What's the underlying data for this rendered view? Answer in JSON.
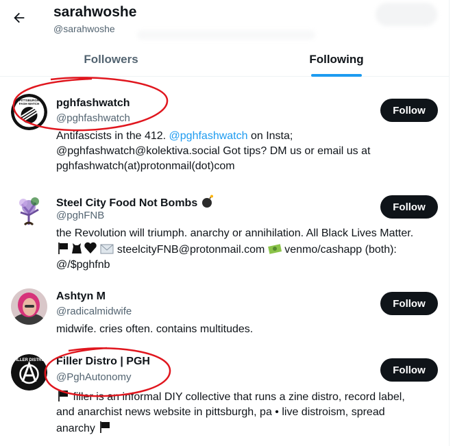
{
  "header": {
    "title": "sarahwoshe",
    "handle": "@sarahwoshe"
  },
  "tabs": [
    {
      "label": "Followers",
      "active": false
    },
    {
      "label": "Following",
      "active": true
    }
  ],
  "users": [
    {
      "name": "pghfashwatch",
      "handle": "@pghfashwatch",
      "button": "Follow",
      "bio_lines": [
        [
          "Antifascists in the 412. ",
          "@pghfashwatch",
          " on Insta;"
        ],
        [
          "@pghfashwatch@kolektiva.social Got tips? DM us or email us at"
        ],
        [
          "pghfashwatch(at)protonmail(dot)com"
        ]
      ],
      "avatar_text": [
        "PITTSBURGH",
        "FASH WATCH"
      ]
    },
    {
      "name": "Steel City Food Not Bombs",
      "handle": "@pghFNB",
      "button": "Follow",
      "bio_lines": [
        [
          "the Revolution will triumph. anarchy or annihilation. All Black Lives Matter."
        ],
        [
          " steelcityFNB@protonmail.com ",
          " venmo/cashapp (both):"
        ],
        [
          "@/$pghfnb"
        ]
      ]
    },
    {
      "name": "Ashtyn M",
      "handle": "@radicalmidwife",
      "button": "Follow",
      "bio_lines": [
        [
          "midwife. cries often. contains multitudes."
        ]
      ]
    },
    {
      "name": "Filler Distro | PGH",
      "handle": "@PghAutonomy",
      "button": "Follow",
      "bio_lines": [
        [
          " filler is an informal DIY collective that runs a zine distro, record label,"
        ],
        [
          "and anarchist news website in pittsburgh, pa • live distroism, spread"
        ],
        [
          "anarchy "
        ]
      ],
      "avatar_text": [
        "FILLER DISTRO"
      ]
    }
  ],
  "colors": {
    "accent": "#1d9bf0",
    "text": "#0f1419",
    "muted": "#536471",
    "button": "#0f1419",
    "annotation": "#e0161e"
  },
  "icons": [
    "back-arrow-icon",
    "bomb-emoji",
    "black-flag-emoji",
    "black-cat-emoji",
    "black-heart-emoji",
    "envelope-emoji",
    "money-emoji"
  ]
}
